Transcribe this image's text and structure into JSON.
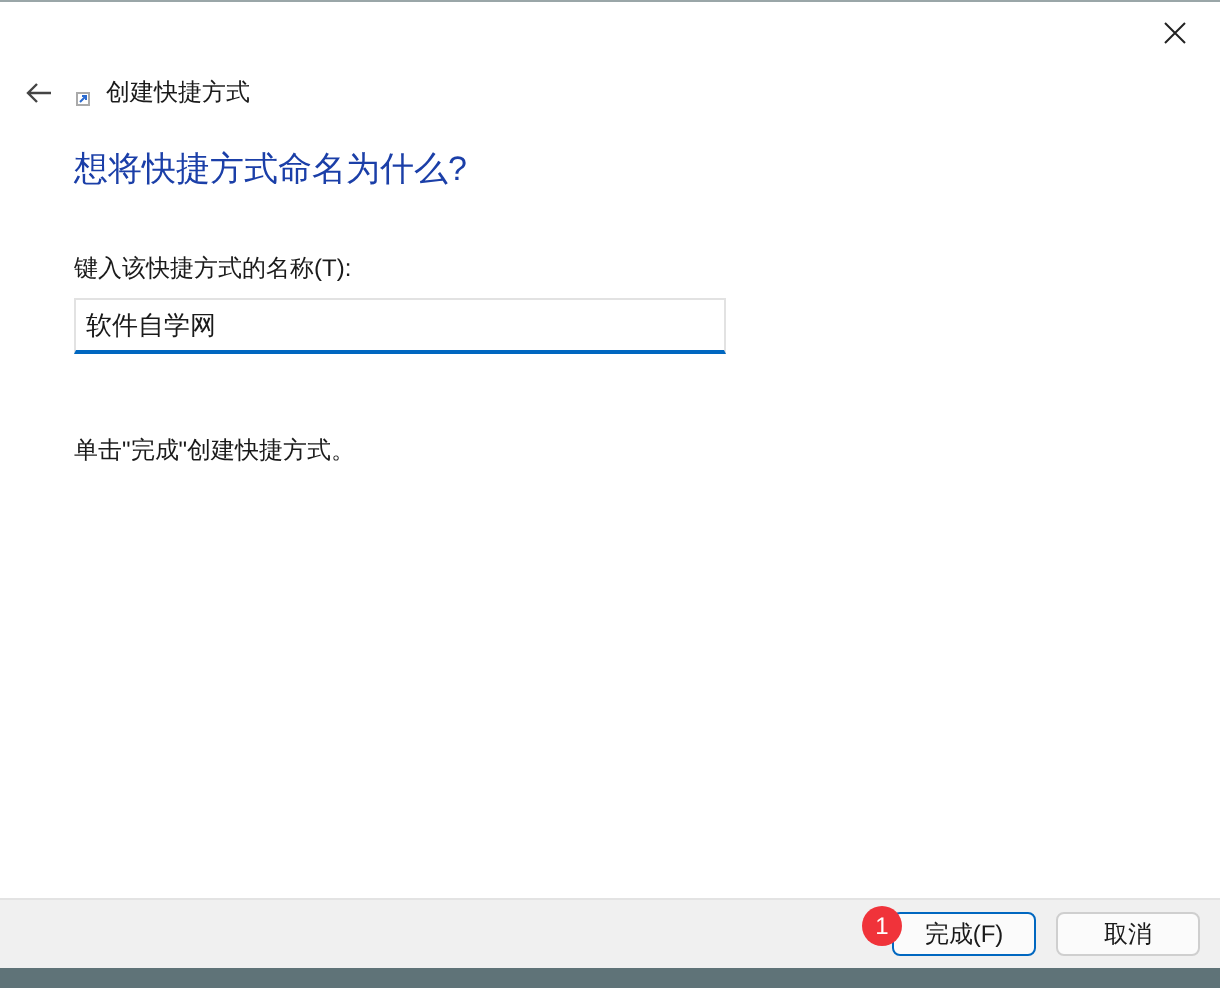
{
  "window": {
    "title": "创建快捷方式"
  },
  "heading": "想将快捷方式命名为什么?",
  "name_field": {
    "label": "键入该快捷方式的名称(T):",
    "value": "软件自学网"
  },
  "instruction": "单击\"完成\"创建快捷方式。",
  "buttons": [
    {
      "label": "完成(F)",
      "kind": "primary",
      "badge": "1"
    },
    {
      "label": "取消",
      "kind": "secondary"
    }
  ]
}
